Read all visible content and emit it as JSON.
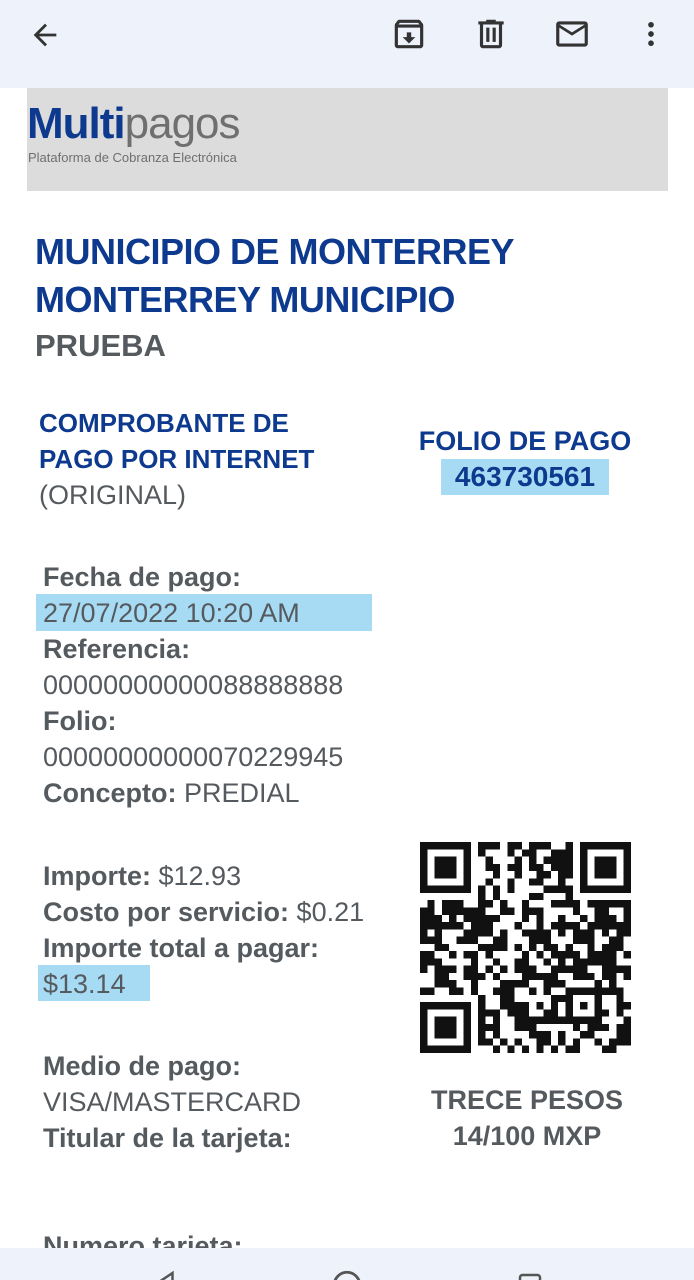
{
  "toolbar": {
    "icons": [
      "back-arrow-icon",
      "archive-icon",
      "delete-icon",
      "mail-icon",
      "more-vert-icon"
    ]
  },
  "logo": {
    "main_a": "Multi",
    "main_b": "pagos",
    "tagline": "Plataforma de Cobranza Electrónica"
  },
  "receipt": {
    "title_line1": "MUNICIPIO DE MONTERREY",
    "title_line2": "MONTERREY MUNICIPIO",
    "subtitle": "PRUEBA",
    "comp_line1": "COMPROBANTE DE",
    "comp_line2": "PAGO POR INTERNET",
    "comp_original": "(ORIGINAL)",
    "folio_label": "FOLIO DE PAGO",
    "folio_value": "463730561",
    "fecha_label": "Fecha de pago:",
    "fecha_value": "27/07/2022 10:20 AM",
    "referencia_label": "Referencia:",
    "referencia_value": "00000000000088888888",
    "folio2_label": "Folio:",
    "folio2_value": "00000000000070229945",
    "concepto_label": "Concepto:",
    "concepto_value": " PREDIAL",
    "importe_label": "Importe:",
    "importe_value": " $12.93",
    "costo_label": "Costo por servicio:",
    "costo_value": " $0.21",
    "total_label": "Importe total a pagar:",
    "total_value": "$13.14",
    "medio_label": "Medio de pago:",
    "medio_value": "VISA/MASTERCARD",
    "titular_label": "Titular de la tarjeta:",
    "numero_label": "Numero tarjeta:",
    "amount_words_line1": "TRECE PESOS",
    "amount_words_line2": "14/100 MXP"
  },
  "colors": {
    "brand_blue": "#0d3a8e",
    "text_gray": "#555a5f",
    "highlight": "#a7dbf3",
    "toolbar_bg": "#eef2fb"
  }
}
